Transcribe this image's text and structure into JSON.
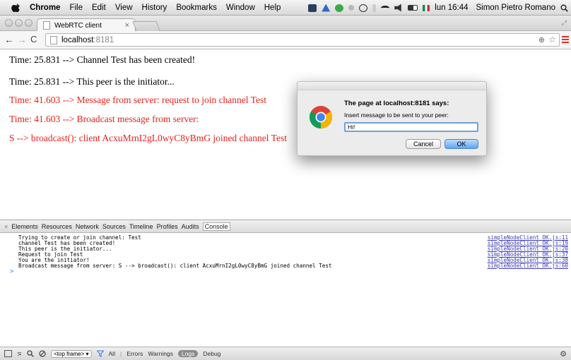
{
  "menubar": {
    "app": "Chrome",
    "items": [
      "File",
      "Edit",
      "View",
      "History",
      "Bookmarks",
      "Window",
      "Help"
    ],
    "clock": "lun 16:44",
    "user": "Simon Pietro Romano"
  },
  "browser": {
    "tab_title": "WebRTC client",
    "url_host": "localhost",
    "url_port": ":8181"
  },
  "page": {
    "messages": [
      {
        "text": "Time: 25.831 --> Channel Test has been created!",
        "color": "#000000"
      },
      {
        "text": "Time: 25.831 --> This peer is the initiator...",
        "color": "#000000"
      },
      {
        "text": "Time: 41.603 --> Message from server: request to join channel Test",
        "color": "#e8211b"
      },
      {
        "text": "Time: 41.603 --> Broadcast message from server:",
        "color": "#e8211b"
      },
      {
        "text": "S --> broadcast(): client AcxuMrnI2gL0wyC8yBmG joined channel Test",
        "color": "#e8211b"
      }
    ]
  },
  "dialog": {
    "title": "The page at localhost:8181 says:",
    "message": "Insert message to be sent to your peer:",
    "input_value": "Hi!",
    "cancel_label": "Cancel",
    "ok_label": "OK"
  },
  "devtools": {
    "tabs": [
      "Elements",
      "Resources",
      "Network",
      "Sources",
      "Timeline",
      "Profiles",
      "Audits",
      "Console"
    ],
    "active_tab": "Console",
    "logs": [
      {
        "text": "Trying to create or join channel:  Test",
        "source": "simpleNodeClient_OK.js:11"
      },
      {
        "text": "channel Test has been created!",
        "source": "simpleNodeClient_OK.js:19"
      },
      {
        "text": "This peer is the initiator...",
        "source": "simpleNodeClient_OK.js:20"
      },
      {
        "text": "Request to join Test",
        "source": "simpleNodeClient_OK.js:37"
      },
      {
        "text": "You are the initiator!",
        "source": "simpleNodeClient_OK.js:38"
      },
      {
        "text": "Broadcast message from server: S --> broadcast(): client AcxuMrnI2gL0wyC8yBmG joined channel Test",
        "source": "simpleNodeClient_OK.js:60"
      }
    ],
    "prompt": ">",
    "frame_select": "<top frame>",
    "filters": [
      "All",
      "Errors",
      "Warnings",
      "Logs",
      "Debug"
    ],
    "active_filter": "Logs"
  }
}
